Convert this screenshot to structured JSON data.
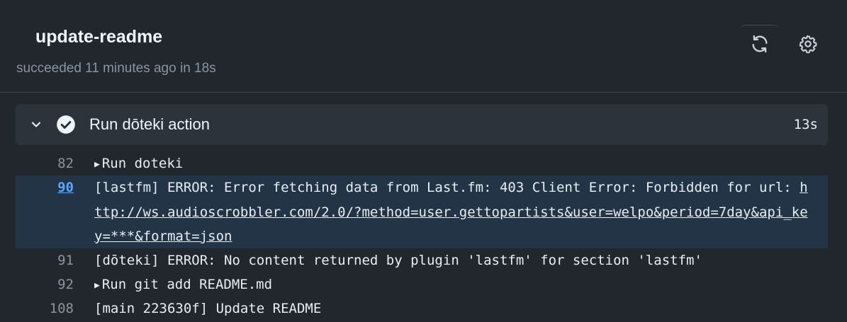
{
  "header": {
    "title": "update-readme",
    "status": "succeeded 11 minutes ago in 18s",
    "rerun_icon": "sync-icon",
    "settings_icon": "gear-icon"
  },
  "step": {
    "name": "Run dōteki action",
    "duration": "13s",
    "status": "success"
  },
  "lines": [
    {
      "num": "82",
      "text": "Run doteki",
      "collapsible": true
    },
    {
      "num": "90",
      "text_prefix": "[lastfm] ERROR: Error fetching data from Last.fm: 403 Client Error: Forbidden for url: ",
      "link": "http://ws.audioscrobbler.com/2.0/?method=user.gettopartists&user=welpo&period=7day&api_key=***&format=json",
      "highlighted": true
    },
    {
      "num": "91",
      "text": "[dōteki] ERROR: No content returned by plugin 'lastfm' for section 'lastfm'"
    },
    {
      "num": "92",
      "text": "Run git add README.md",
      "collapsible": true
    },
    {
      "num": "108",
      "text": "[main 223630f] Update README"
    }
  ],
  "colors": {
    "background": "#22272e",
    "highlight": "#243447",
    "link_number": "#58a6ff",
    "muted": "#8b949e"
  }
}
